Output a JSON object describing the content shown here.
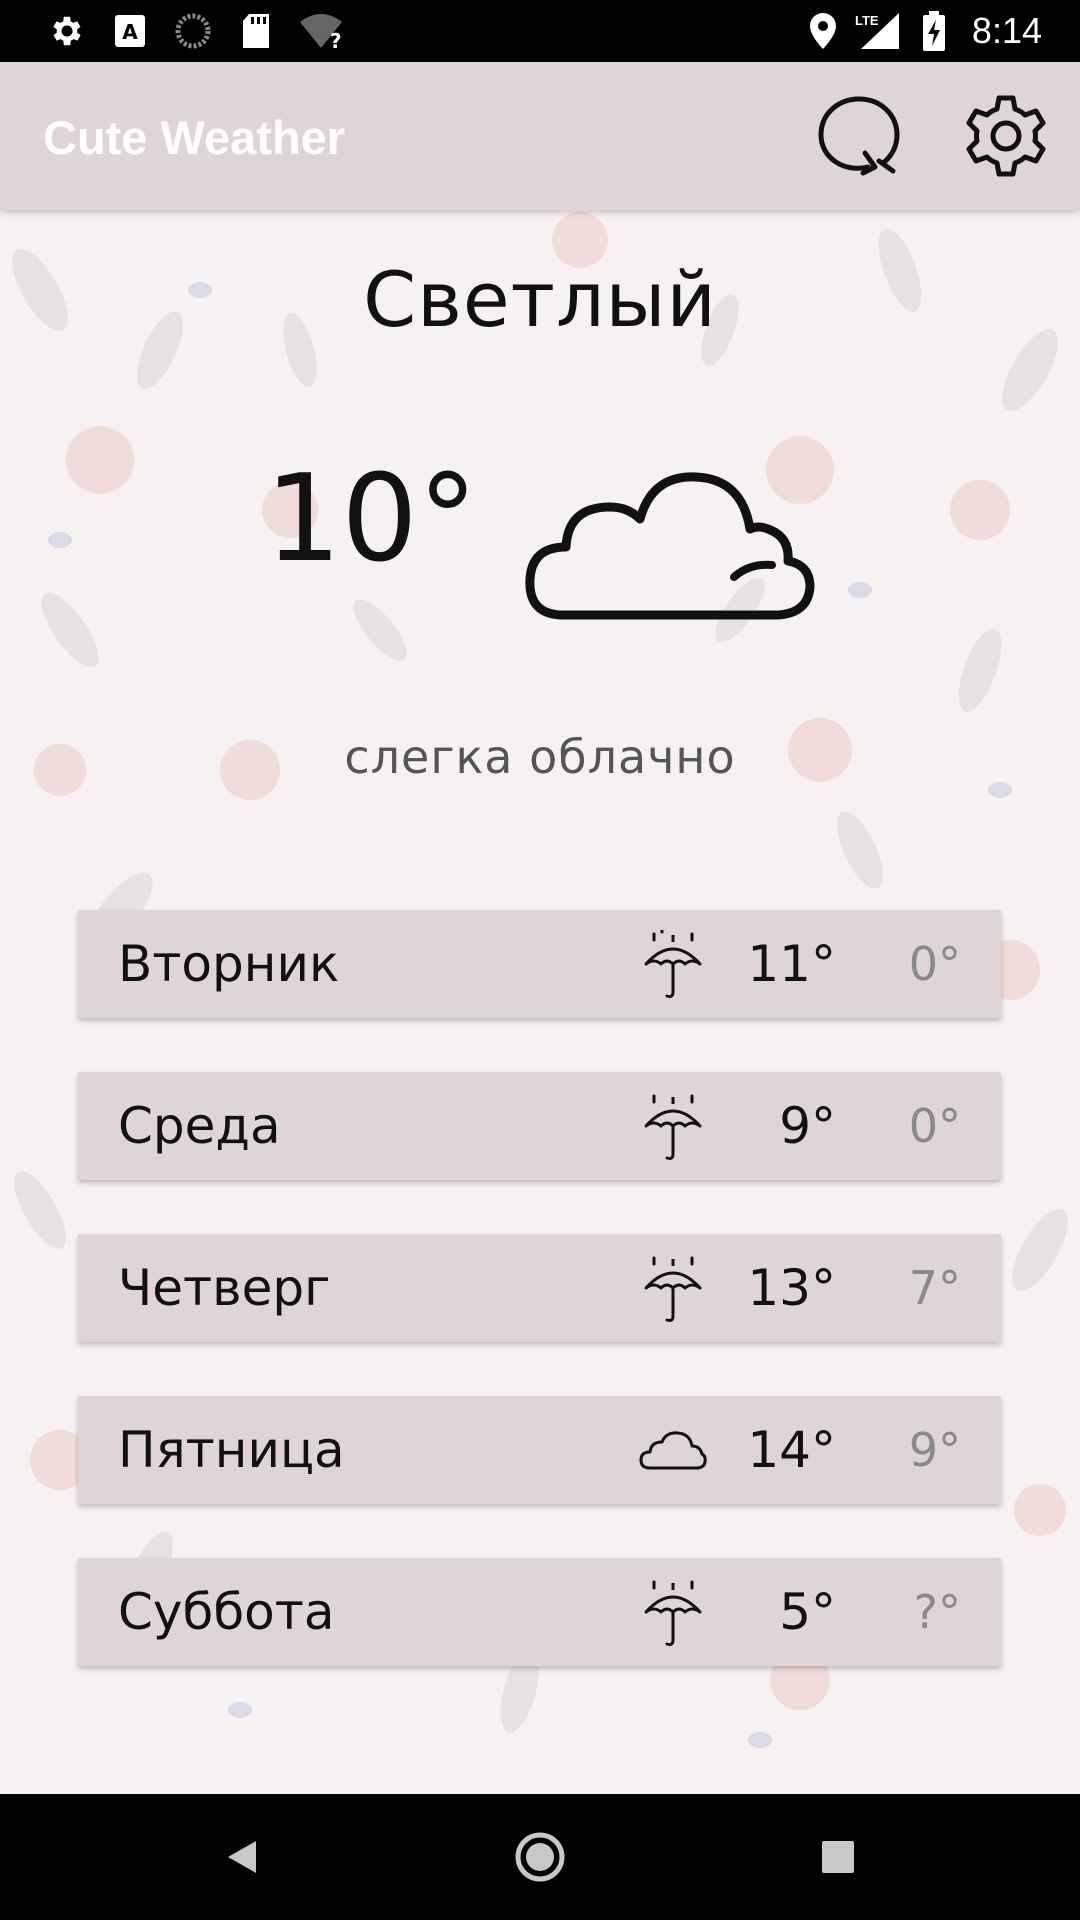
{
  "status_bar": {
    "time": "8:14",
    "network": "LTE",
    "icons": [
      "settings-icon",
      "font-a-icon",
      "sync-circle-icon",
      "sd-card-icon",
      "wifi-unknown-icon",
      "location-icon",
      "signal-icon",
      "battery-charging-icon"
    ]
  },
  "app_bar": {
    "title": "Cute Weather",
    "refresh_icon": "refresh-icon",
    "settings_icon": "gear-icon"
  },
  "current": {
    "city": "Светлый",
    "temperature": "10°",
    "condition_icon": "cloud-icon",
    "condition": "слегка облачно"
  },
  "forecast": [
    {
      "day": "Вторник",
      "icon": "umbrella-icon",
      "high": "11°",
      "low": "0°"
    },
    {
      "day": "Среда",
      "icon": "umbrella-icon",
      "high": "9°",
      "low": "0°"
    },
    {
      "day": "Четверг",
      "icon": "umbrella-icon",
      "high": "13°",
      "low": "7°"
    },
    {
      "day": "Пятница",
      "icon": "cloud-icon",
      "high": "14°",
      "low": "9°"
    },
    {
      "day": "Суббота",
      "icon": "umbrella-icon",
      "high": "5°",
      "low": "?°"
    }
  ],
  "colors": {
    "app_bar": "#e0d5d6",
    "row_background": "#e0d5d6",
    "page_background": "#f6f2f1",
    "low_temp_text": "#8a8a8a"
  },
  "nav_bar": {
    "icons": [
      "back-icon",
      "home-icon",
      "recents-icon"
    ]
  }
}
